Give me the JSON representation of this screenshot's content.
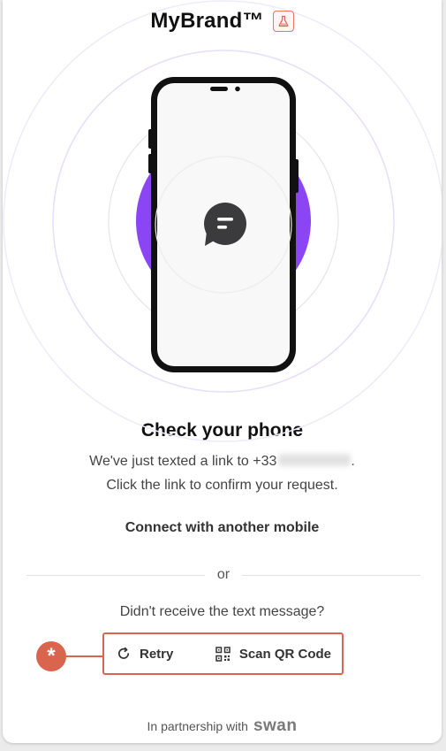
{
  "brand": {
    "name": "MyBrand™",
    "badge_icon": "flask-icon"
  },
  "illustration": {
    "accent_color": "#8b45f5",
    "message_icon": "chat-bubble-icon"
  },
  "content": {
    "headline": "Check your phone",
    "sms_text": "We've just texted a link to +33",
    "sms_text_end": ".",
    "confirm_text": "Click the link to confirm your request.",
    "connect_link": "Connect with another mobile",
    "or_text": "or",
    "not_received": "Didn't receive the text message?"
  },
  "actions": {
    "retry_label": "Retry",
    "retry_icon": "refresh-icon",
    "scan_label": "Scan QR Code",
    "scan_icon": "qr-code-icon"
  },
  "marker": {
    "symbol": "*",
    "color": "#d9654f"
  },
  "footer": {
    "text": "In partnership with",
    "partner": "swan"
  }
}
